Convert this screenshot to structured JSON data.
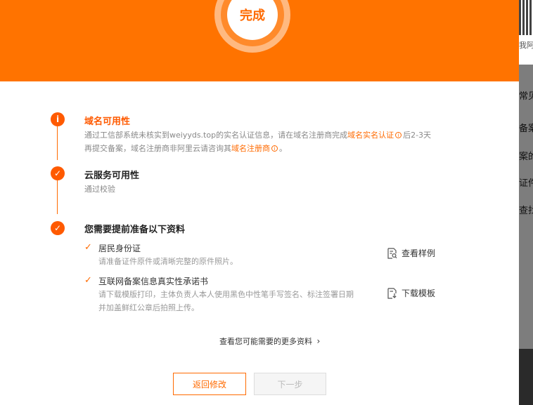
{
  "hero": {
    "badge_text": "完成"
  },
  "steps": [
    {
      "title": "域名可用性",
      "status": "warning",
      "desc_line1_prefix": "通过工信部系统未核实到weiyyds.top的实名认证信息，请在域名注册商完成",
      "desc_link1": "域名实名认证",
      "desc_line1_suffix": "后2-3天",
      "desc_line2_prefix": "再提交备案，域名注册商非阿里云请咨询其",
      "desc_link2": "域名注册商",
      "desc_line2_suffix": "。"
    },
    {
      "title": "云服务可用性",
      "status": "done",
      "desc": "通过校验"
    },
    {
      "title": "您需要提前准备以下资料",
      "status": "done"
    }
  ],
  "materials": [
    {
      "title": "居民身份证",
      "desc": "请准备证件原件或清晰完整的原件照片。",
      "action": "查看样例"
    },
    {
      "title": "互联网备案信息真实性承诺书",
      "desc_line1": "请下载模版打印，主体负责人本人使用黑色中性笔手写签名、标注签署日期",
      "desc_line2": "并加盖鲜红公章后拍照上传。",
      "action": "下载模板"
    }
  ],
  "more_link": "查看您可能需要的更多资料",
  "buttons": {
    "back": "返回修改",
    "next": "下一步"
  },
  "background": {
    "caption": "我阿里",
    "items": [
      "常见",
      "备案",
      "案的",
      "证件",
      "查找"
    ]
  },
  "colors": {
    "accent": "#ff6a00",
    "hero": "#ff7300"
  },
  "icons": {
    "warning": "info-icon",
    "done": "check-icon"
  }
}
